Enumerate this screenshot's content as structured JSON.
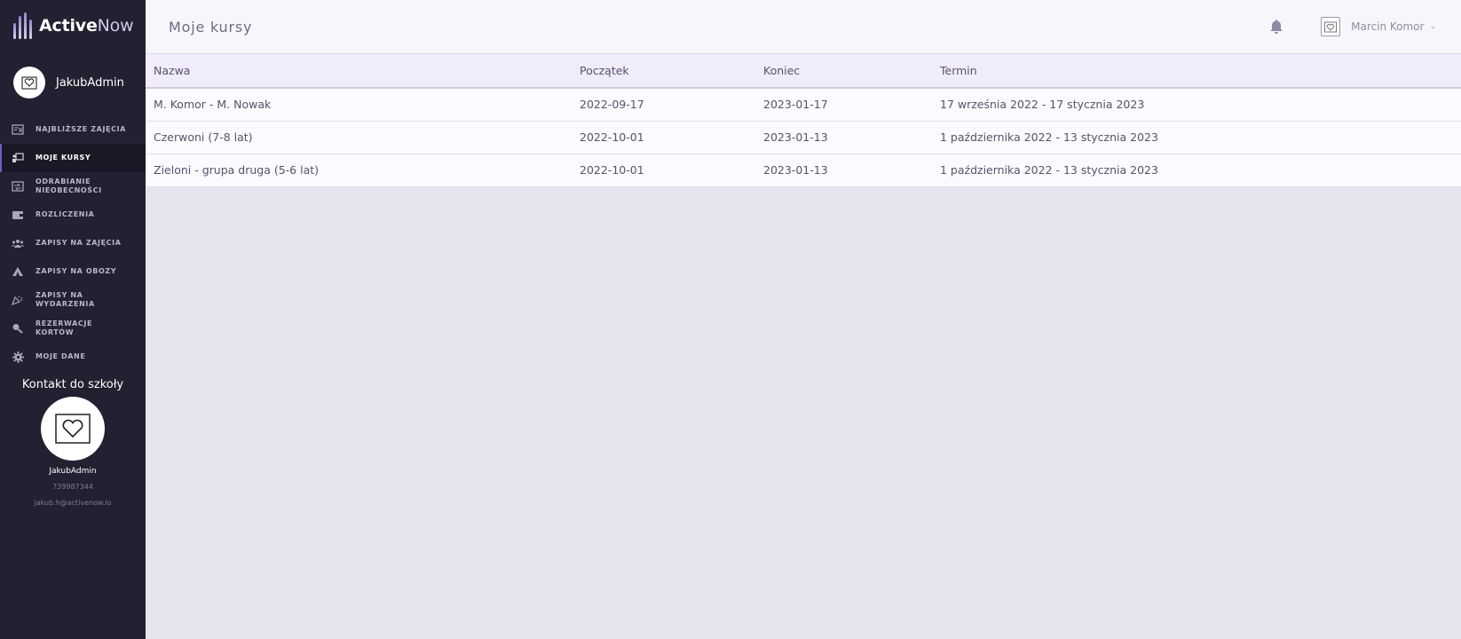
{
  "app": {
    "logo_bold": "Active",
    "logo_light": "Now"
  },
  "sidebar": {
    "user_name": "JakubAdmin",
    "items": [
      {
        "label": "NAJBLIŻSZE ZAJĘCIA",
        "icon": "calendar-board-icon"
      },
      {
        "label": "MOJE KURSY",
        "icon": "teacher-board-icon",
        "active": true
      },
      {
        "label": "ODRABIANIE NIEOBECNOŚCI",
        "icon": "swap-board-icon"
      },
      {
        "label": "ROZLICZENIA",
        "icon": "wallet-icon"
      },
      {
        "label": "ZAPISY NA ZAJĘCIA",
        "icon": "users-group-icon"
      },
      {
        "label": "ZAPISY NA OBOZY",
        "icon": "tent-icon"
      },
      {
        "label": "ZAPISY NA WYDARZENIA",
        "icon": "party-popper-icon"
      },
      {
        "label": "REZERWACJE KORTÓW",
        "icon": "racket-icon"
      },
      {
        "label": "MOJE DANE",
        "icon": "gear-icon"
      }
    ],
    "contact": {
      "title": "Kontakt do szkoły",
      "name": "JakubAdmin",
      "phone": "739987344",
      "email": "jakub.h@activenow.io"
    }
  },
  "header": {
    "title": "Moje kursy",
    "user_name": "Marcin Komor"
  },
  "table": {
    "columns": [
      "Nazwa",
      "Początek",
      "Koniec",
      "Termin"
    ],
    "rows": [
      [
        "M. Komor - M. Nowak",
        "2022-09-17",
        "2023-01-17",
        "17 września 2022 - 17 stycznia 2023"
      ],
      [
        "Czerwoni (7-8 lat)",
        "2022-10-01",
        "2023-01-13",
        "1 października 2022 - 13 stycznia 2023"
      ],
      [
        "Zieloni - grupa druga (5-6 lat)",
        "2022-10-01",
        "2023-01-13",
        "1 października 2022 - 13 stycznia 2023"
      ]
    ]
  },
  "colors": {
    "sidebar_bg": "#222031",
    "accent": "#6a5fc1",
    "table_header_bg": "#f0ecfb",
    "content_bg": "#e6e3ef"
  }
}
